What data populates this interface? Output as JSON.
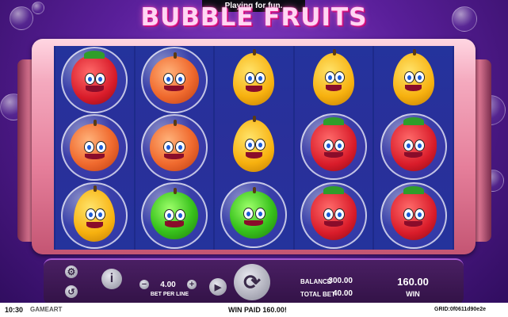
{
  "toast": "Playing for fun.",
  "game_title": "BUBBLE FRUITS",
  "reels": [
    [
      "strawberry",
      "peach-orange",
      "orange"
    ],
    [
      "peach-orange",
      "peach-orange",
      "kiwi"
    ],
    [
      "lemon",
      "lemon",
      "kiwi"
    ],
    [
      "lemon",
      "strawberry",
      "strawberry"
    ],
    [
      "lemon",
      "strawberry",
      "strawberry"
    ]
  ],
  "bubbled": [
    [
      true,
      true,
      true
    ],
    [
      true,
      true,
      true
    ],
    [
      false,
      false,
      true
    ],
    [
      false,
      true,
      true
    ],
    [
      false,
      true,
      true
    ]
  ],
  "controls": {
    "bet_per_line_value": "4.00",
    "bet_per_line_label": "BET PER LINE",
    "minus_label": "−",
    "plus_label": "+",
    "info_label": "i",
    "balance_label": "BALANCE",
    "balance_value": "300.00",
    "total_bet_label": "TOTAL BET",
    "total_bet_value": "40.00",
    "win_value": "160.00",
    "win_label": "WIN"
  },
  "footer": {
    "clock": "10:30",
    "brand": "GAMEART",
    "win_message": "WIN PAID 160.00!",
    "grid_id": "GRID:0f0611d90e2e"
  },
  "icons": [
    "gear-icon",
    "history-icon",
    "info-icon",
    "minus-icon",
    "plus-icon",
    "autoplay-icon",
    "spin-icon"
  ]
}
